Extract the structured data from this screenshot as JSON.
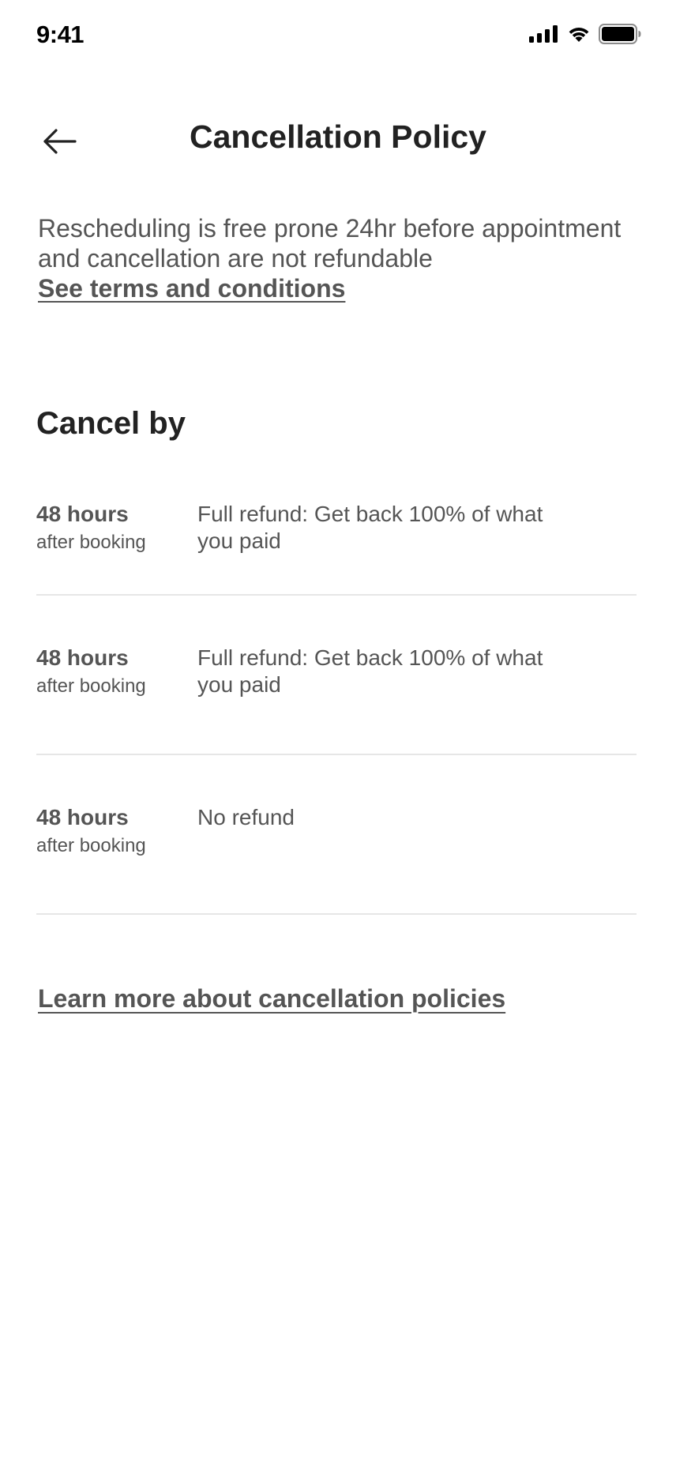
{
  "status_bar": {
    "time": "9:41",
    "icons": [
      "signal-icon",
      "wifi-icon",
      "battery-icon"
    ]
  },
  "header": {
    "title": "Cancellation Policy",
    "back_icon": "arrow-left-icon"
  },
  "intro": {
    "text": "Rescheduling is free prone 24hr before appointment and cancellation are not refundable",
    "link_label": "See terms and conditions"
  },
  "cancel_section": {
    "title": "Cancel by",
    "rows": [
      {
        "hours": "48 hours",
        "sub": "after booking",
        "desc": "Full refund: Get back 100% of what you paid"
      },
      {
        "hours": "48 hours",
        "sub": "after booking",
        "desc": "Full refund: Get back 100% of what you paid"
      },
      {
        "hours": "48 hours",
        "sub": "after booking",
        "desc": "No refund"
      }
    ]
  },
  "footer_link": {
    "label": "Learn more about cancellation policies"
  },
  "colors": {
    "heading": "#222222",
    "body": "#555555",
    "divider": "#e6e6e6"
  }
}
